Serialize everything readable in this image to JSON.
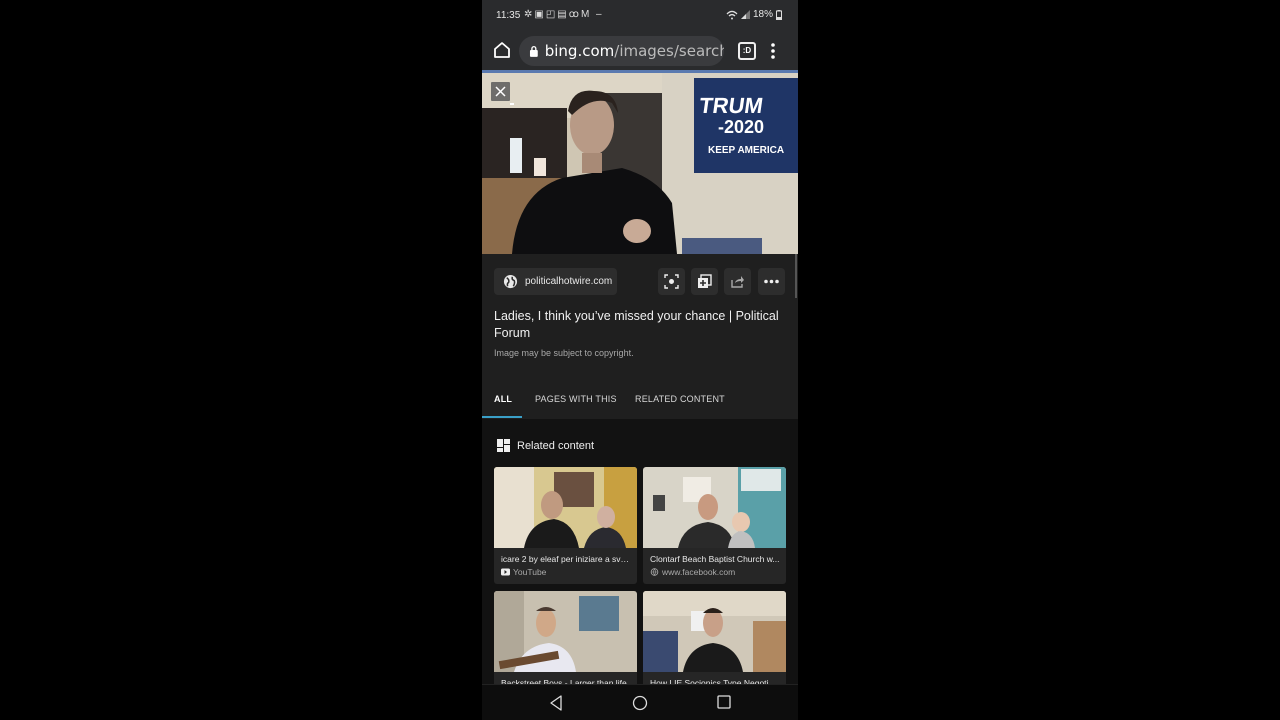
{
  "status_bar": {
    "time": "11:35",
    "notification_icons": [
      "fan-icon",
      "gallery-icon",
      "cast-icon",
      "calendar-icon",
      "voicemail-icon",
      "gmail-icon",
      "dash-icon"
    ],
    "battery": "18%"
  },
  "browser": {
    "url_domain": "bing.com",
    "url_path": "/images/search",
    "tabs_label": ":D"
  },
  "image_detail": {
    "source_chip": "politicalhotwire.com",
    "actions": [
      "visual-search",
      "collections-add",
      "share",
      "more"
    ],
    "title": "Ladies, I think you’ve missed your chance | Political Forum",
    "copyright_note": "Image may be subject to copyright."
  },
  "tabs": [
    {
      "label": "ALL",
      "active": true
    },
    {
      "label": "PAGES WITH THIS",
      "active": false
    },
    {
      "label": "RELATED CONTENT",
      "active": false
    }
  ],
  "related": {
    "heading": "Related content",
    "cards": [
      {
        "title": "icare 2 by eleaf per iniziare a sva...",
        "source": "YouTube",
        "source_icon": "youtube-icon"
      },
      {
        "title": "Clontarf Beach Baptist Church w...",
        "source": "www.facebook.com",
        "source_icon": "globe-icon"
      },
      {
        "title": "Backstreet Boys - Larger than life",
        "source": "",
        "source_icon": ""
      },
      {
        "title": "How LIE Socionics Type Negotiat...",
        "source": "",
        "source_icon": ""
      }
    ]
  },
  "colors": {
    "accent": "#3aa0c8",
    "background": "#121212",
    "panel": "#1f1f1f"
  }
}
